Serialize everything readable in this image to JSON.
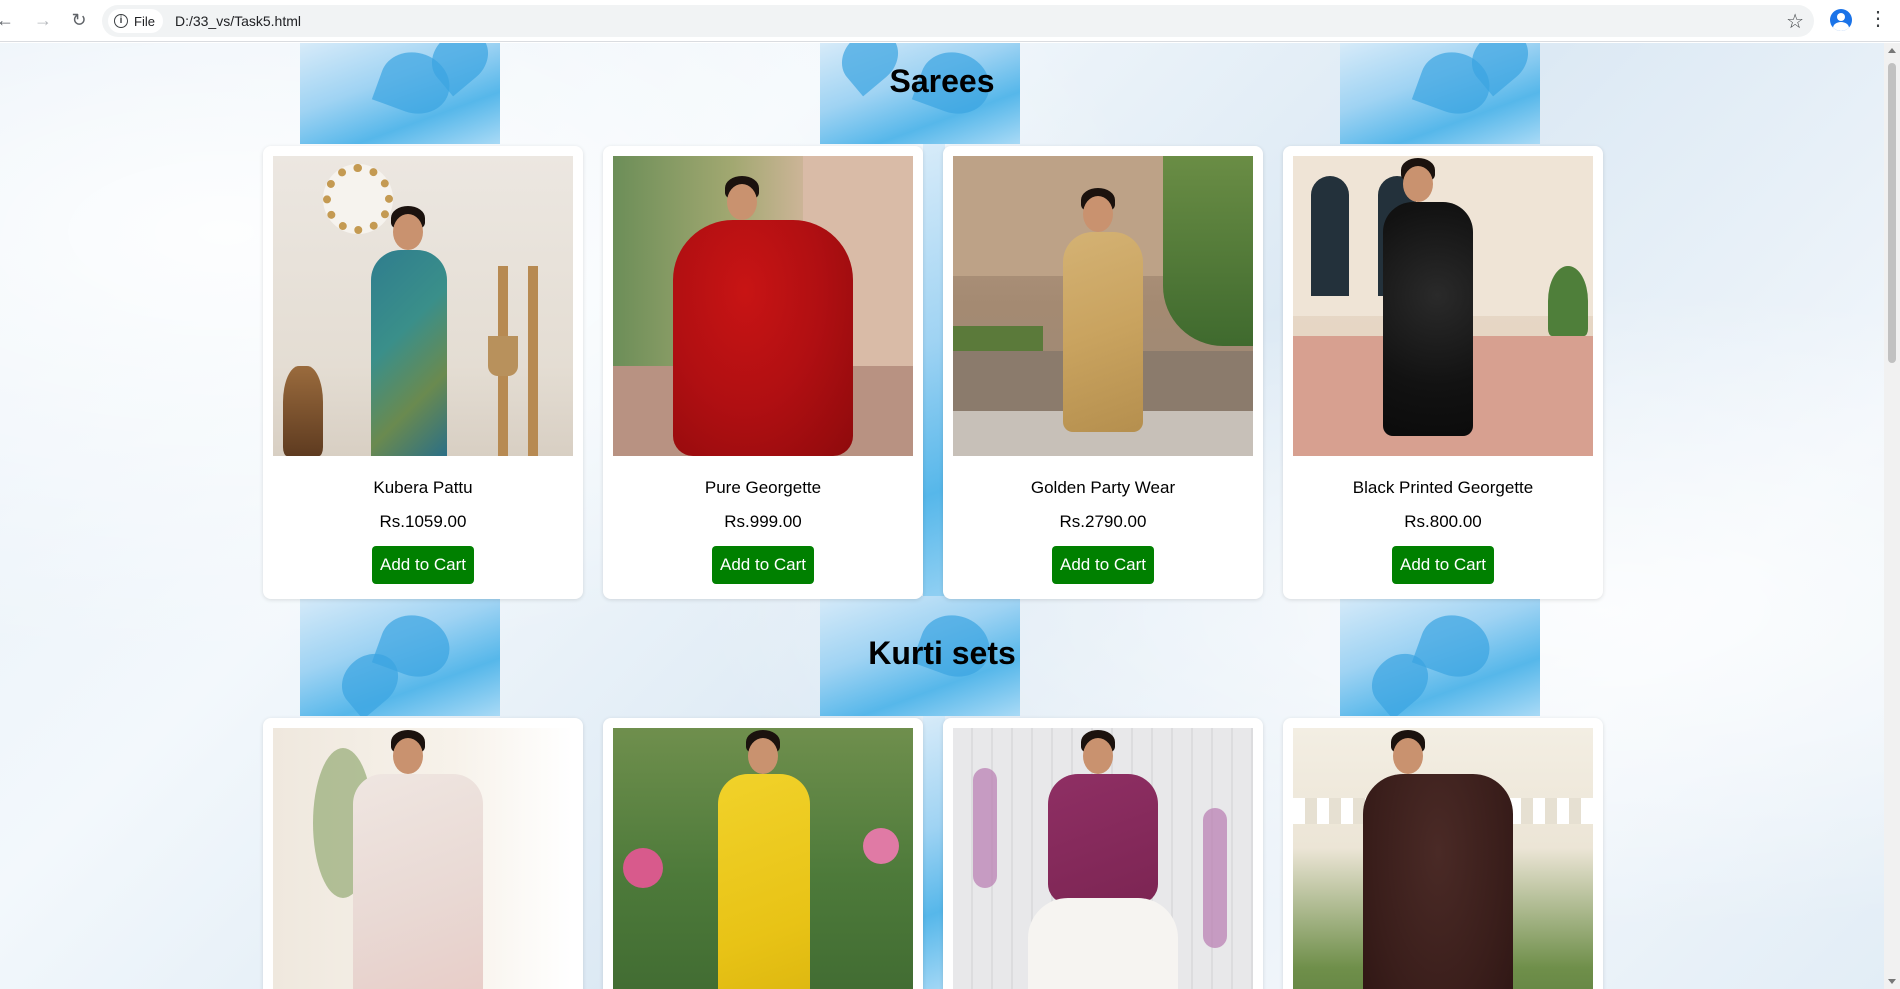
{
  "browser": {
    "site_info_label": "File",
    "url": "D:/33_vs/Task5.html"
  },
  "sections": [
    {
      "title": "Sarees",
      "products": [
        {
          "name": "Kubera Pattu",
          "price": "Rs.1059.00",
          "button": "Add to Cart"
        },
        {
          "name": "Pure Georgette",
          "price": "Rs.999.00",
          "button": "Add to Cart"
        },
        {
          "name": "Golden Party Wear",
          "price": "Rs.2790.00",
          "button": "Add to Cart"
        },
        {
          "name": "Black Printed Georgette",
          "price": "Rs.800.00",
          "button": "Add to Cart"
        }
      ]
    },
    {
      "title": "Kurti sets",
      "products": [
        {},
        {},
        {},
        {}
      ]
    }
  ],
  "colors": {
    "add_to_cart_button": "#008000",
    "page_background": "#e8f1f8",
    "flower_accent": "#4fb2e8"
  }
}
